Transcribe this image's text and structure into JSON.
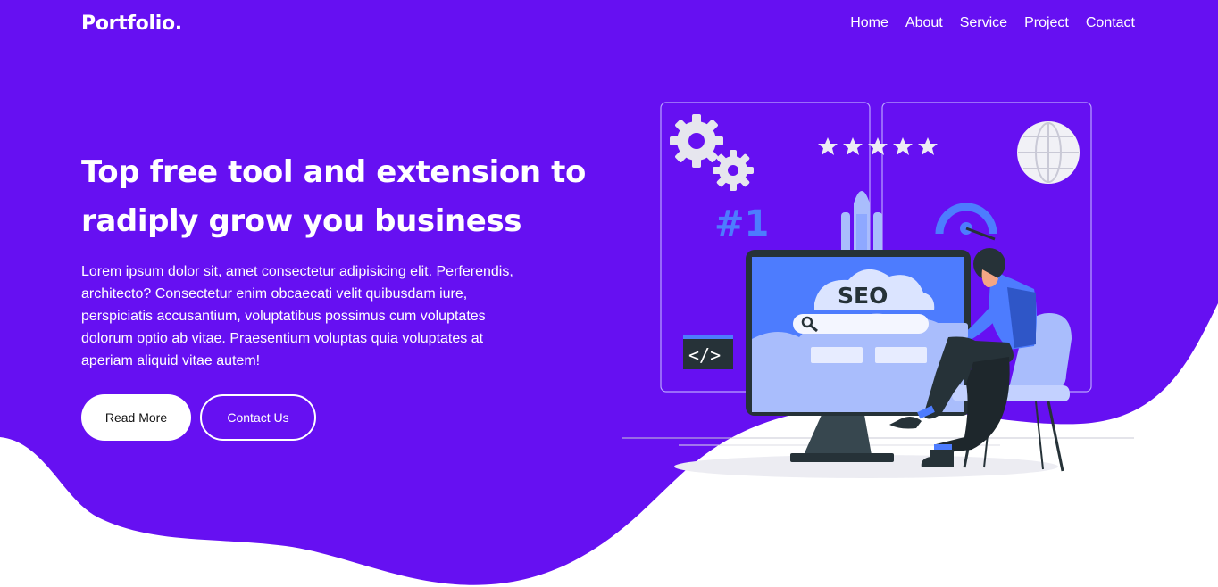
{
  "colors": {
    "primary": "#6610f2",
    "white": "#ffffff",
    "illustration_blue": "#4d7cfe",
    "illustration_light_blue": "#a9bdfc",
    "illustration_dark": "#263238"
  },
  "header": {
    "logo": "Portfolio.",
    "nav": [
      "Home",
      "About",
      "Service",
      "Project",
      "Contact"
    ]
  },
  "hero": {
    "title_line1": "Top free tool and extension to",
    "title_line2": "radiply grow you business",
    "description_lines": [
      "Lorem ipsum dolor sit, amet consectetur adipisicing elit. Perferendis,",
      "architecto? Consectetur enim obcaecati velit quibusdam iure,",
      "perspiciatis accusantium, voluptatibus possimus cum voluptates",
      "dolorum optio ab vitae. Praesentium voluptas quia voluptates at",
      "aperiam aliquid vitae autem!"
    ],
    "primary_button": "Read More",
    "secondary_button": "Contact Us"
  },
  "illustration": {
    "seo_label": "SEO",
    "rank_label": "#1",
    "code_label": "</>",
    "stars": 5,
    "icons": [
      "gears-icon",
      "globe-icon",
      "rocket-icon",
      "gauge-icon",
      "search-icon",
      "code-icon",
      "person-on-chair",
      "monitor"
    ]
  }
}
